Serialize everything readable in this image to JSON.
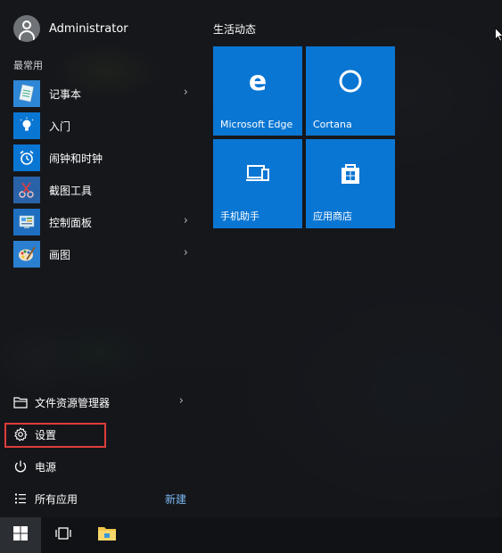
{
  "user": {
    "name": "Administrator"
  },
  "most_used": {
    "label": "最常用",
    "items": [
      {
        "label": "记事本",
        "icon": "notepad-icon",
        "has_submenu": true
      },
      {
        "label": "入门",
        "icon": "get-started-icon",
        "has_submenu": false
      },
      {
        "label": "闹钟和时钟",
        "icon": "alarm-clock-icon",
        "has_submenu": false
      },
      {
        "label": "截图工具",
        "icon": "snipping-tool-icon",
        "has_submenu": false
      },
      {
        "label": "控制面板",
        "icon": "control-panel-icon",
        "has_submenu": true
      },
      {
        "label": "画图",
        "icon": "paint-icon",
        "has_submenu": true
      }
    ]
  },
  "bottom": {
    "explorer_label": "文件资源管理器",
    "settings_label": "设置",
    "power_label": "电源",
    "all_apps_label": "所有应用",
    "new_label": "新建"
  },
  "tiles": {
    "header": "生活动态",
    "items": [
      {
        "label": "Microsoft Edge",
        "icon": "edge-icon"
      },
      {
        "label": "Cortana",
        "icon": "cortana-icon"
      },
      {
        "label": "手机助手",
        "icon": "phone-companion-icon"
      },
      {
        "label": "应用商店",
        "icon": "store-icon"
      }
    ]
  },
  "colors": {
    "tile_blue": "#0a76d3",
    "highlight_red": "#e03c3c",
    "link_blue": "#7cb6f0"
  },
  "taskbar": {
    "items": [
      "windows-start-icon",
      "task-view-icon",
      "file-explorer-icon"
    ]
  }
}
